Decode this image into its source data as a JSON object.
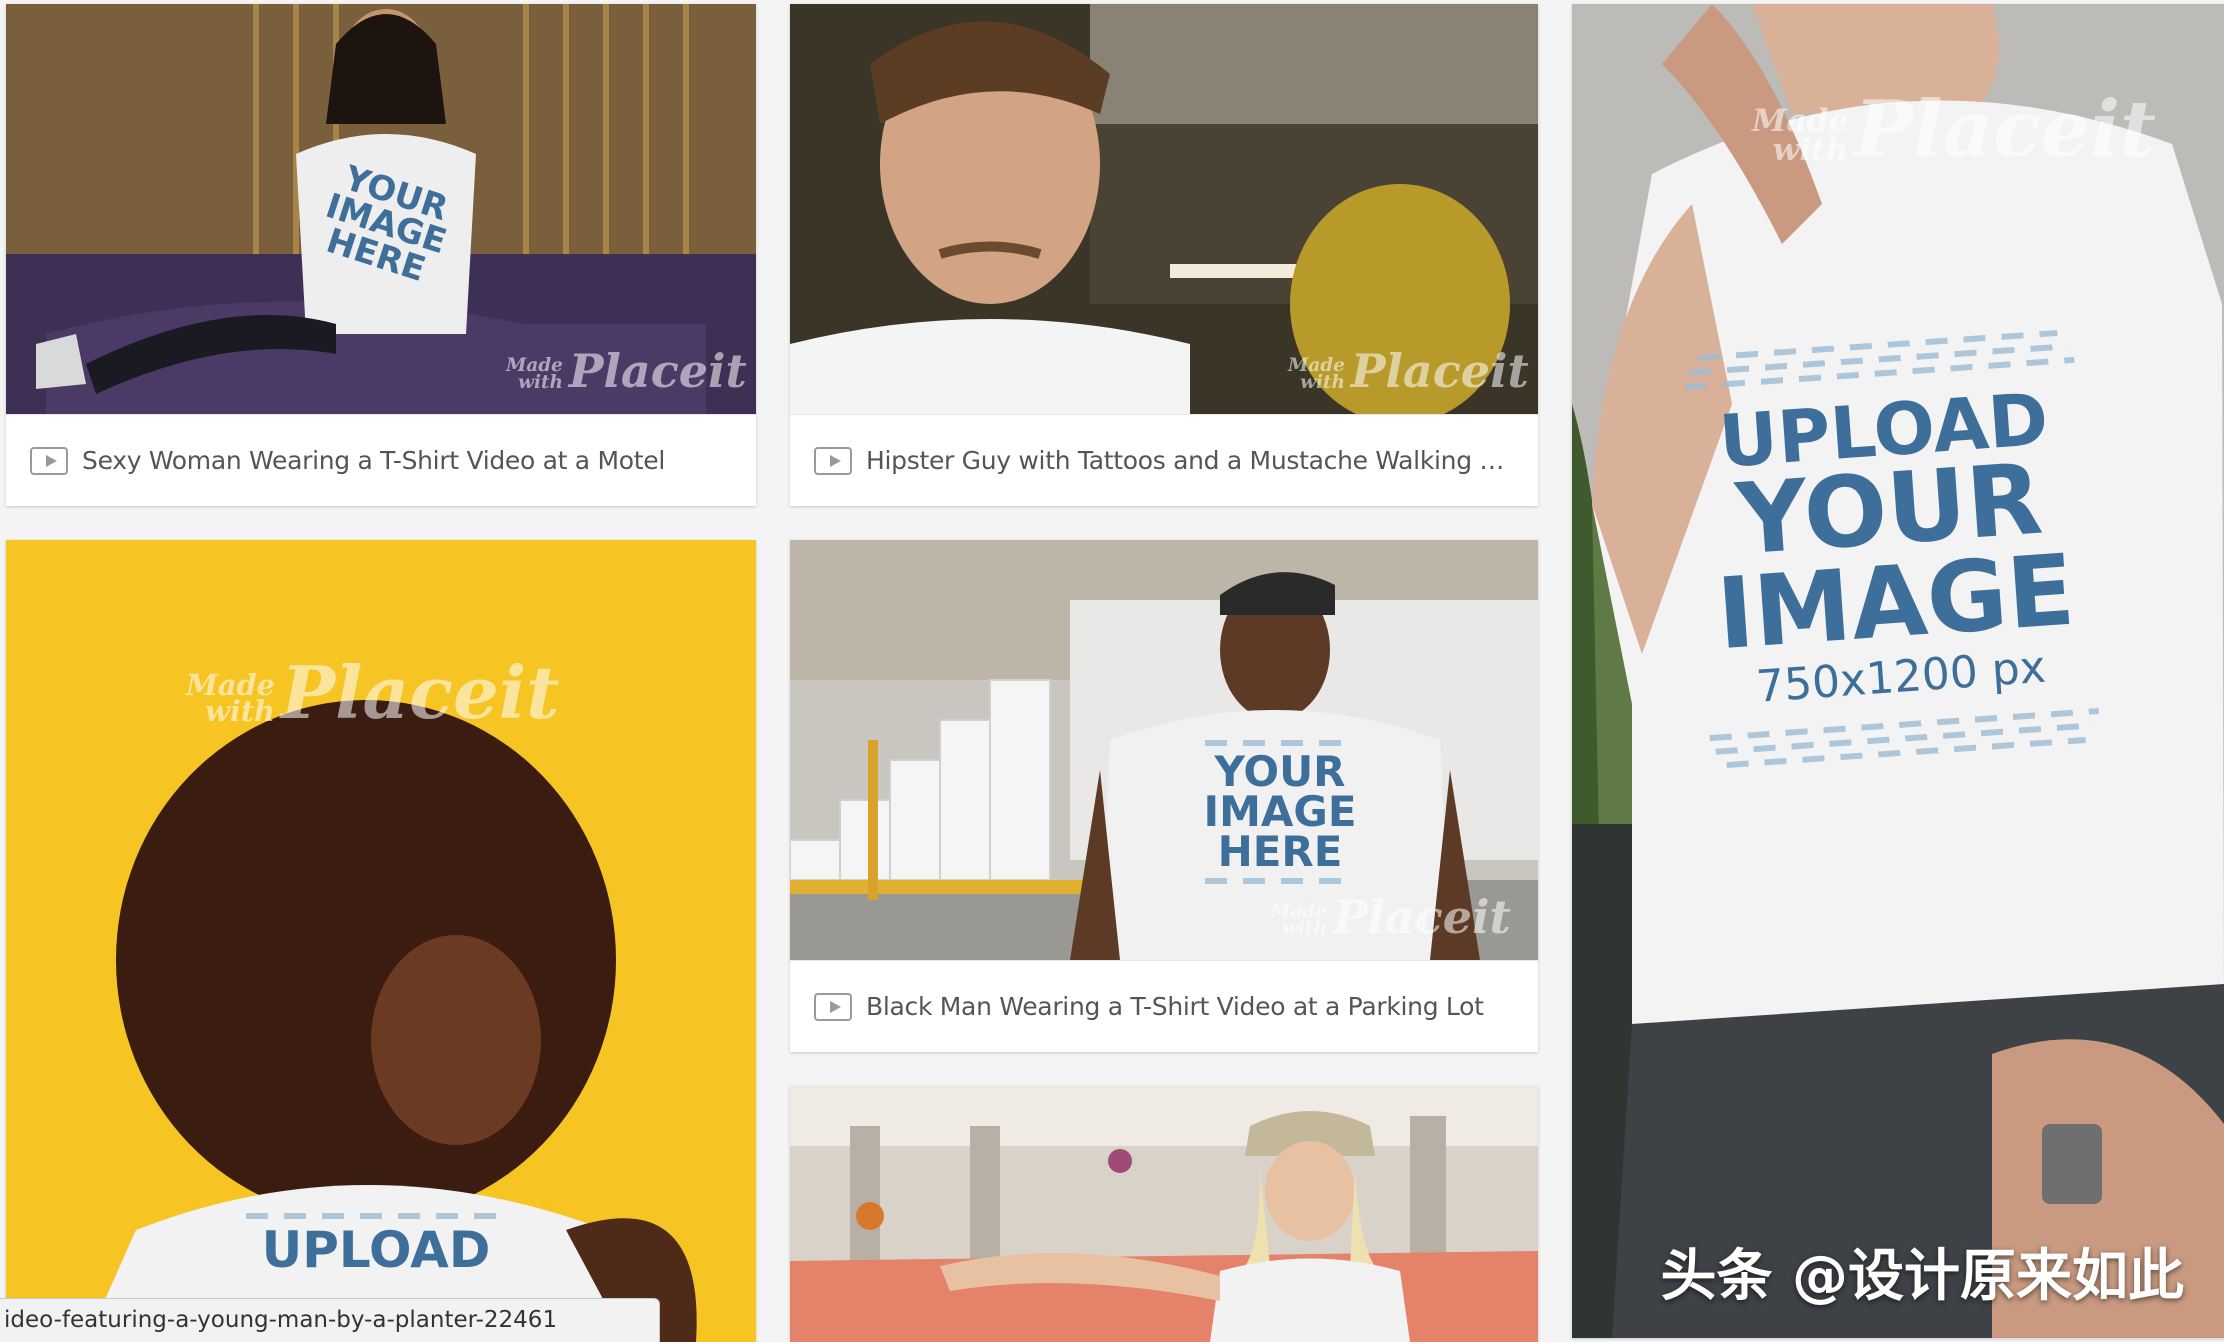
{
  "cards": [
    {
      "title": "Sexy Woman Wearing a T-Shirt Video at a Motel",
      "print": [
        "YOUR",
        "IMAGE",
        "HERE"
      ],
      "watermark": {
        "small_top": "Made",
        "small_bottom": "with",
        "brand": "Placeit"
      }
    },
    {
      "title": "Hipster Guy with Tattoos and a Mustache Walking Through a...",
      "watermark": {
        "small_top": "Made",
        "small_bottom": "with",
        "brand": "Placeit"
      }
    },
    {
      "title": "Black Man Wearing a T-Shirt Video at a Parking Lot",
      "print": [
        "YOUR",
        "IMAGE",
        "HERE"
      ],
      "watermark": {
        "small_top": "Made",
        "small_bottom": "with",
        "brand": "Placeit"
      }
    },
    {
      "print": [
        "UPLOAD"
      ],
      "watermark": {
        "small_top": "Made",
        "small_bottom": "with",
        "brand": "Placeit"
      }
    },
    {
      "description": "woman in cap and glasses sitting on orange sofa"
    },
    {
      "print": [
        "UPLOAD",
        "YOUR",
        "IMAGE",
        "750x1200 px"
      ],
      "watermark": {
        "small_top": "Made",
        "small_bottom": "with",
        "brand": "Placeit"
      }
    }
  ],
  "status_bar": {
    "url": "ideo-featuring-a-young-man-by-a-planter-22461"
  },
  "overlay": {
    "text": "头条 @设计原来如此"
  },
  "colors": {
    "page_bg": "#f4f4f4",
    "card_bg": "#ffffff",
    "caption_text": "#555555",
    "print_blue": "#3d6f9a",
    "yellow_bg": "#f6c423"
  },
  "icons": {
    "caption_icon": "play-icon"
  }
}
